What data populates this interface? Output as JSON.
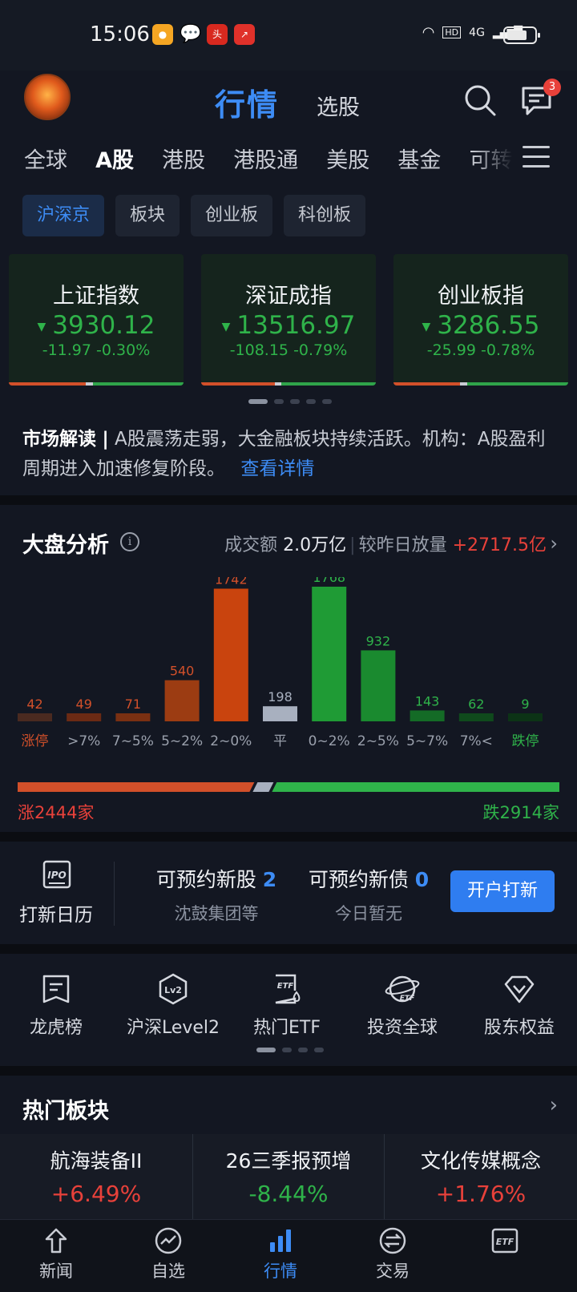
{
  "status_bar": {
    "time": "15:06",
    "network": "4G",
    "hd": "HD",
    "app_icons": [
      "weibo-icon",
      "wechat-icon",
      "toutiao-icon",
      "stock-app-icon"
    ]
  },
  "header": {
    "title": "行情",
    "subtitle": "选股",
    "message_badge": "3"
  },
  "market_tabs": [
    "全球",
    "A股",
    "港股",
    "港股通",
    "美股",
    "基金",
    "可转"
  ],
  "active_market_tab": "A股",
  "sub_tabs": [
    "沪深京",
    "板块",
    "创业板",
    "科创板"
  ],
  "active_sub_tab": "沪深京",
  "indices": [
    {
      "name": "上证指数",
      "value": "3930.12",
      "change": "-11.97",
      "percent": "-0.30%",
      "arrow": "▼"
    },
    {
      "name": "深证成指",
      "value": "13516.97",
      "change": "-108.15",
      "percent": "-0.79%",
      "arrow": "▼"
    },
    {
      "name": "创业板指",
      "value": "3286.55",
      "change": "-25.99",
      "percent": "-0.78%",
      "arrow": "▼"
    }
  ],
  "commentary": {
    "label": "市场解读",
    "sep": "|",
    "text": "A股震荡走弱，大金融板块持续活跃。机构：A股盈利周期进入加速修复阶段。",
    "link": "查看详情"
  },
  "analysis": {
    "title": "大盘分析",
    "turnover_label": "成交额",
    "turnover_value": "2.0万亿",
    "compare_label": "较昨日放量",
    "compare_value": "+2717.5亿",
    "up_label": "涨2444家",
    "down_label": "跌2914家",
    "up_count": 2444,
    "down_count": 2914,
    "flat_count": 198
  },
  "chart_data": {
    "type": "bar",
    "categories": [
      "涨停",
      ">7%",
      "7~5%",
      "5~2%",
      "2~0%",
      "平",
      "0~2%",
      "2~5%",
      "5~7%",
      "7%<",
      "跌停"
    ],
    "values": [
      42,
      49,
      71,
      540,
      1742,
      198,
      1768,
      932,
      143,
      62,
      9
    ],
    "colors": [
      "#4a2a20",
      "#6b2a14",
      "#7a3012",
      "#9c3c12",
      "#c9440e",
      "#a8b0bf",
      "#1f9b35",
      "#1a8a2f",
      "#146b26",
      "#0f4a1c",
      "#0c3316"
    ],
    "label_colors": [
      "#d2502a",
      "#d2502a",
      "#d2502a",
      "#d2502a",
      "#d2502a",
      "#a8b0bf",
      "#2fb34a",
      "#2fb34a",
      "#2fb34a",
      "#2fb34a",
      "#2fb34a"
    ],
    "title": "",
    "xlabel": "",
    "ylabel": ""
  },
  "ipo": {
    "calendar_label": "打新日历",
    "stocks_label": "可预约新股",
    "stocks_count": "2",
    "stocks_sub": "沈鼓集团等",
    "bonds_label": "可预约新债",
    "bonds_count": "0",
    "bonds_sub": "今日暂无",
    "button": "开户打新"
  },
  "shortcuts": [
    {
      "label": "龙虎榜",
      "icon": "list-icon"
    },
    {
      "label": "沪深Level2",
      "icon": "lv2-icon"
    },
    {
      "label": "热门ETF",
      "icon": "etf-doc-icon"
    },
    {
      "label": "投资全球",
      "icon": "globe-icon"
    },
    {
      "label": "股东权益",
      "icon": "diamond-icon"
    }
  ],
  "hot_sectors": {
    "title": "热门板块",
    "items": [
      {
        "name": "航海装备II",
        "percent": "+6.49%",
        "direction": "up"
      },
      {
        "name": "26三季报预增",
        "percent": "-8.44%",
        "direction": "down"
      },
      {
        "name": "文化传媒概念",
        "percent": "+1.76%",
        "direction": "up"
      }
    ]
  },
  "bottom_nav": [
    {
      "label": "新闻",
      "icon": "news-icon"
    },
    {
      "label": "自选",
      "icon": "watchlist-icon"
    },
    {
      "label": "行情",
      "icon": "market-chart-icon"
    },
    {
      "label": "交易",
      "icon": "trade-icon"
    },
    {
      "label": "",
      "icon": "etf-icon"
    }
  ],
  "active_nav": "行情",
  "colors": {
    "accent": "#3d8cf5",
    "up": "#e8413a",
    "down": "#2fb34a",
    "background": "#131722"
  }
}
